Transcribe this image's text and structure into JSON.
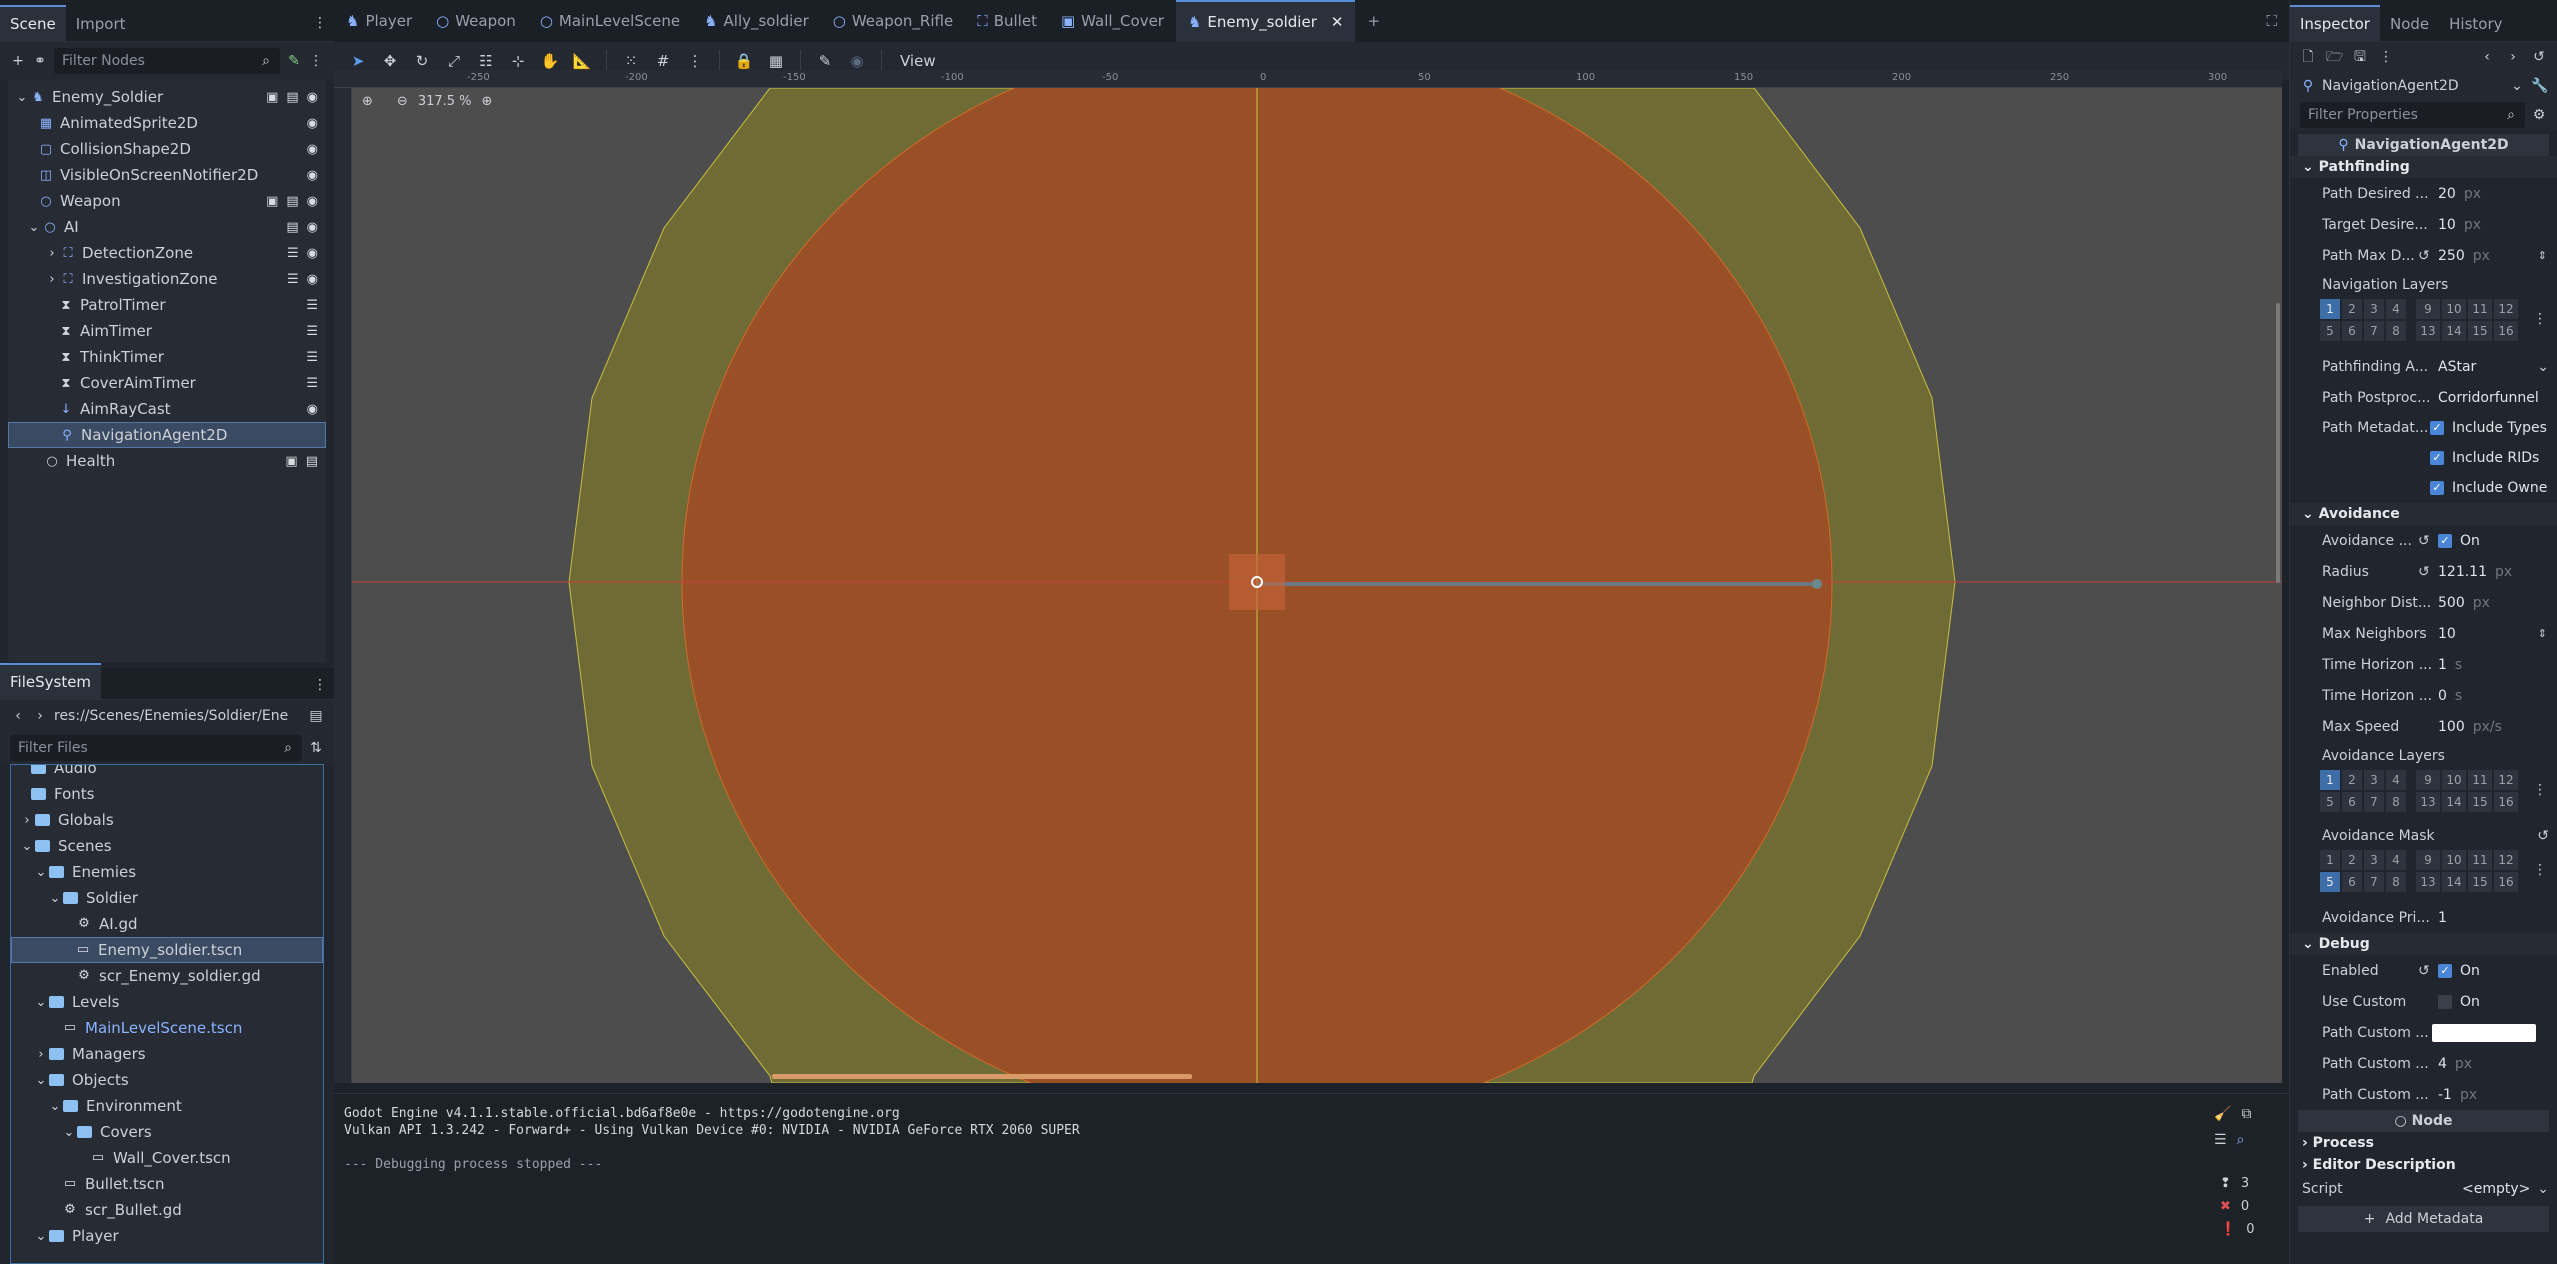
{
  "scene_dock": {
    "tabs": [
      "Scene",
      "Import"
    ],
    "filter_placeholder": "Filter Nodes",
    "nodes": [
      {
        "label": "Enemy_Soldier",
        "icon": "character-icon"
      },
      {
        "label": "AnimatedSprite2D",
        "icon": "animated-sprite-icon"
      },
      {
        "label": "CollisionShape2D",
        "icon": "collision-shape-icon"
      },
      {
        "label": "VisibleOnScreenNotifier2D",
        "icon": "notifier-icon"
      },
      {
        "label": "Weapon",
        "icon": "node2d-icon"
      },
      {
        "label": "AI",
        "icon": "node-icon"
      },
      {
        "label": "DetectionZone",
        "icon": "area-icon"
      },
      {
        "label": "InvestigationZone",
        "icon": "area-icon"
      },
      {
        "label": "PatrolTimer",
        "icon": "timer-icon"
      },
      {
        "label": "AimTimer",
        "icon": "timer-icon"
      },
      {
        "label": "ThinkTimer",
        "icon": "timer-icon"
      },
      {
        "label": "CoverAimTimer",
        "icon": "timer-icon"
      },
      {
        "label": "AimRayCast",
        "icon": "raycast-icon"
      },
      {
        "label": "NavigationAgent2D",
        "icon": "navigation-icon"
      },
      {
        "label": "Health",
        "icon": "node-icon"
      }
    ]
  },
  "filesystem": {
    "tab": "FileSystem",
    "path": "res://Scenes/Enemies/Soldier/Ene",
    "filter_placeholder": "Filter Files",
    "items": [
      {
        "label": "Audio",
        "type": "folder"
      },
      {
        "label": "Fonts",
        "type": "folder"
      },
      {
        "label": "Globals",
        "type": "folder"
      },
      {
        "label": "Scenes",
        "type": "folder"
      },
      {
        "label": "Enemies",
        "type": "folder"
      },
      {
        "label": "Soldier",
        "type": "folder"
      },
      {
        "label": "AI.gd",
        "type": "script"
      },
      {
        "label": "Enemy_soldier.tscn",
        "type": "scene"
      },
      {
        "label": "scr_Enemy_soldier.gd",
        "type": "script"
      },
      {
        "label": "Levels",
        "type": "folder"
      },
      {
        "label": "MainLevelScene.tscn",
        "type": "scene"
      },
      {
        "label": "Managers",
        "type": "folder"
      },
      {
        "label": "Objects",
        "type": "folder"
      },
      {
        "label": "Environment",
        "type": "folder"
      },
      {
        "label": "Covers",
        "type": "folder"
      },
      {
        "label": "Wall_Cover.tscn",
        "type": "scene"
      },
      {
        "label": "Bullet.tscn",
        "type": "scene"
      },
      {
        "label": "scr_Bullet.gd",
        "type": "script"
      },
      {
        "label": "Player",
        "type": "folder"
      }
    ]
  },
  "scene_tabs": [
    "Player",
    "Weapon",
    "MainLevelScene",
    "Ally_soldier",
    "Weapon_Rifle",
    "Bullet",
    "Wall_Cover",
    "Enemy_soldier"
  ],
  "editor_toolbar": {
    "view_label": "View"
  },
  "viewport": {
    "zoom": "317.5 %"
  },
  "ruler_ticks": [
    "-250",
    "-200",
    "-150",
    "-100",
    "-50",
    "0",
    "50",
    "100",
    "150",
    "200",
    "250",
    "300"
  ],
  "output": {
    "lines": [
      "Godot Engine v4.1.1.stable.official.bd6af8e0e - https://godotengine.org",
      "Vulkan API 1.3.242 - Forward+ - Using Vulkan Device #0: NVIDIA - NVIDIA GeForce RTX 2060 SUPER",
      "",
      "--- Debugging process stopped ---"
    ],
    "counts": {
      "messages": "3",
      "errors": "0",
      "warnings": "0"
    }
  },
  "inspector": {
    "tabs": [
      "Inspector",
      "Node",
      "History"
    ],
    "node_type": "NavigationAgent2D",
    "filter_placeholder": "Filter Properties",
    "header": "NavigationAgent2D",
    "sections": {
      "pathfinding": "Pathfinding",
      "avoidance": "Avoidance",
      "debug": "Debug",
      "node": "Node",
      "process": "Process",
      "editor_description": "Editor Description"
    },
    "props": {
      "path_desired": {
        "label": "Path Desired ...",
        "value": "20",
        "unit": "px"
      },
      "target_desired": {
        "label": "Target Desire...",
        "value": "10",
        "unit": "px"
      },
      "path_max": {
        "label": "Path Max D...",
        "value": "250",
        "unit": "px"
      },
      "nav_layers": {
        "label": "Navigation Layers"
      },
      "pathfinding_algo": {
        "label": "Pathfinding A...",
        "value": "AStar"
      },
      "path_postproc": {
        "label": "Path Postproc...",
        "value": "Corridorfunnel"
      },
      "path_metadata": {
        "label": "Path Metadat...",
        "options": [
          "Include Types",
          "Include RIDs",
          "Include Owne"
        ]
      },
      "avoidance_enabled": {
        "label": "Avoidance ...",
        "value": "On"
      },
      "radius": {
        "label": "Radius",
        "value": "121.11",
        "unit": "px"
      },
      "neighbor_dist": {
        "label": "Neighbor Dist...",
        "value": "500",
        "unit": "px"
      },
      "max_neighbors": {
        "label": "Max Neighbors",
        "value": "10"
      },
      "time_horizon_1": {
        "label": "Time Horizon ...",
        "value": "1",
        "unit": "s"
      },
      "time_horizon_2": {
        "label": "Time Horizon ...",
        "value": "0",
        "unit": "s"
      },
      "max_speed": {
        "label": "Max Speed",
        "value": "100",
        "unit": "px/s"
      },
      "avoidance_layers": {
        "label": "Avoidance Layers"
      },
      "avoidance_mask": {
        "label": "Avoidance Mask"
      },
      "avoidance_priority": {
        "label": "Avoidance Pri...",
        "value": "1"
      },
      "debug_enabled": {
        "label": "Enabled",
        "value": "On"
      },
      "use_custom": {
        "label": "Use Custom",
        "value": "On"
      },
      "path_custom_color": {
        "label": "Path Custom ..."
      },
      "path_custom_2": {
        "label": "Path Custom ...",
        "value": "4",
        "unit": "px"
      },
      "path_custom_3": {
        "label": "Path Custom ...",
        "value": "-1",
        "unit": "px"
      }
    },
    "script": {
      "label": "Script",
      "value": "<empty>"
    },
    "add_metadata": "Add Metadata",
    "layer_numbers": [
      "1",
      "2",
      "3",
      "4",
      "9",
      "10",
      "11",
      "12",
      "5",
      "6",
      "7",
      "8",
      "13",
      "14",
      "15",
      "16"
    ]
  },
  "colors": {
    "accent": "#5a8fd8",
    "outer_zone": "#6e6b35",
    "inner_zone": "#9a5026",
    "axis_x": "#c83c3c",
    "axis_y": "#c8c83c"
  }
}
